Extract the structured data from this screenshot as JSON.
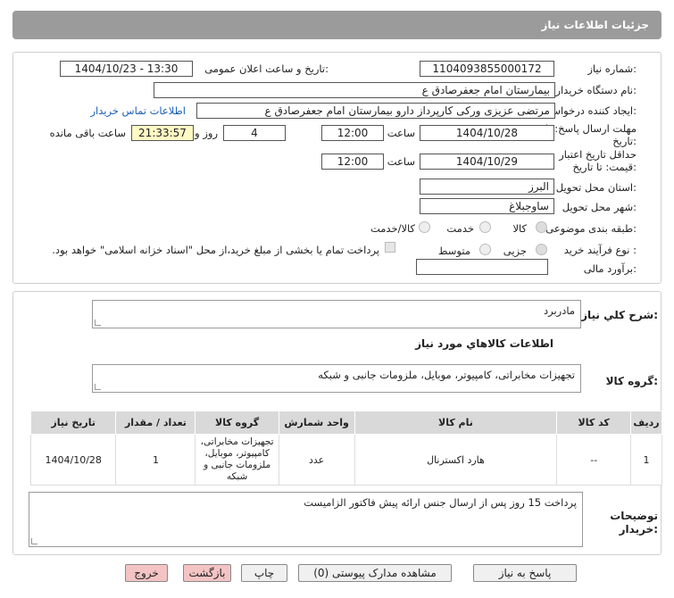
{
  "header": {
    "title": "جزئیات اطلاعات نیاز"
  },
  "fields": {
    "need_number_label": "شماره نیاز:",
    "need_number": "1104093855000172",
    "announce_label": "تاریخ و ساعت اعلان عمومی:",
    "announce_value": "1404/10/23 - 13:30",
    "buyer_org_label": "نام دستگاه خریدار:",
    "buyer_org": "بیمارستان امام جعفرصادق ع",
    "requester_label": "ایجاد کننده درخواست:",
    "requester": "مرتضی عزیزی ورکی کارپرداز دارو بیمارستان امام جعفرصادق ع",
    "contact_link": "اطلاعات تماس خریدار",
    "deadline_label_1": "مهلت ارسال پاسخ: تا",
    "deadline_label_2": "تاریخ:",
    "deadline_date": "1404/10/28",
    "time_label": "ساعت",
    "deadline_time": "12:00",
    "days_value": "4",
    "days_label": "روز و",
    "remaining_time": "21:33:57",
    "remaining_label": "ساعت باقی مانده",
    "validity_label_1": "حداقل تاریخ اعتبار",
    "validity_label_2": "قیمت: تا تاریخ:",
    "validity_date": "1404/10/29",
    "validity_time": "12:00",
    "province_label": "استان محل تحویل:",
    "province": "البرز",
    "city_label": "شهر محل تحویل:",
    "city": "ساوجبلاغ",
    "category_label": "طبقه بندی موضوعی:",
    "cat_goods": "کالا",
    "cat_service": "خدمت",
    "cat_goods_service": "کالا/خدمت",
    "purchase_type_label": "نوع فرآیند خرید :",
    "pt_minor": "جزیی",
    "pt_medium": "متوسط",
    "payment_note": "پرداخت تمام یا بخشی از مبلغ خرید،از محل \"اسناد خزانه اسلامی\" خواهد بود.",
    "estimate_label": "برآورد مالی:",
    "estimate_value": ""
  },
  "summary": {
    "label": "شرح کلي نياز:",
    "value": "مادربرد",
    "goods_info_title": "اطلاعات کالاهاي مورد نياز",
    "goods_group_label": "گروه کالا:",
    "goods_group": "تجهیزات مخابراتی، کامپیوتر، موبایل، ملزومات جانبی و شبکه"
  },
  "table": {
    "headers": [
      "ردیف",
      "کد کالا",
      "نام کالا",
      "واحد شمارش",
      "گروه کالا",
      "تعداد / مقدار",
      "تاریخ نیاز"
    ],
    "rows": [
      [
        "1",
        "--",
        "هارد اکسترنال",
        "عدد",
        "تجهیزات مخابراتی، کامپیوتر، موبایل، ملزومات جانبی و شبکه",
        "1",
        "1404/10/28"
      ]
    ]
  },
  "buyer_notes": {
    "label_1": "توضیحات",
    "label_2": "خریدار:",
    "value": "پرداخت 15 روز پس از ارسال جنس ارائه پیش فاکتور الزامیست"
  },
  "buttons": {
    "reply": "پاسخ به نیاز",
    "attachments": "مشاهده مدارک پیوستی (0)",
    "print": "چاپ",
    "back": "بازگشت",
    "exit": "خروج"
  },
  "colors": {
    "header_bg": "#9b9b9b",
    "countdown_bg": "#fff9c4",
    "danger_btn": "#f4c4c4",
    "link": "#1a5fb4"
  }
}
